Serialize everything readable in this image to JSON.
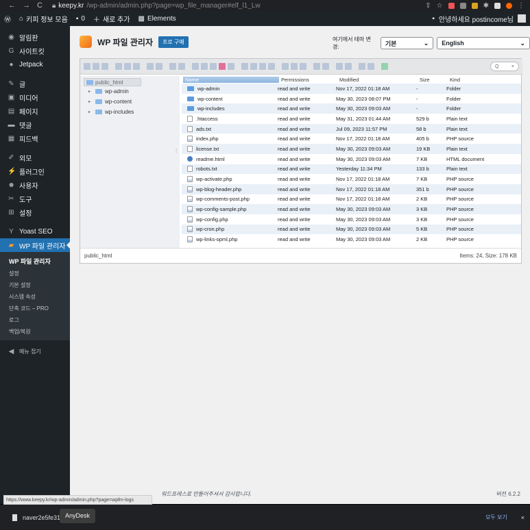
{
  "browser": {
    "nav_icons": [
      "back-icon",
      "forward-icon",
      "reload-icon"
    ],
    "url_host": "keepy.kr",
    "url_path": "/wp-admin/admin.php?page=wp_file_manager#elf_l1_Lw"
  },
  "adminbar": {
    "site_name": "키피 정보 모음",
    "comments_count": "0",
    "new_label": "새로 추가",
    "elements_label": "Elements",
    "greeting": "안녕하세요 postincome님"
  },
  "sidebar": {
    "items": [
      {
        "icon": "dashboard-icon",
        "label": "알림판"
      },
      {
        "icon": "g-icon",
        "label": "사이트킷"
      },
      {
        "icon": "jetpack-icon",
        "label": "Jetpack"
      },
      {
        "icon": "pin-icon",
        "label": "글"
      },
      {
        "icon": "media-icon",
        "label": "미디어"
      },
      {
        "icon": "page-icon",
        "label": "페이지"
      },
      {
        "icon": "comment-icon",
        "label": "댓글"
      },
      {
        "icon": "feedback-icon",
        "label": "피드백"
      },
      {
        "icon": "brush-icon",
        "label": "외모"
      },
      {
        "icon": "plugin-icon",
        "label": "플러그인"
      },
      {
        "icon": "user-icon",
        "label": "사용자"
      },
      {
        "icon": "wrench-icon",
        "label": "도구"
      },
      {
        "icon": "settings-icon",
        "label": "설정"
      },
      {
        "icon": "yoast-icon",
        "label": "Yoast SEO"
      },
      {
        "icon": "file-manager-icon",
        "label": "WP 파일 관리자"
      }
    ],
    "submenu": [
      "WP 파일 관리자",
      "설정",
      "기본 설정",
      "시스템 속성",
      "단축 코드 – PRO",
      "로그",
      "백업/복원"
    ],
    "collapse_label": "메뉴 접기"
  },
  "header": {
    "title": "WP 파일 관리자",
    "pro_button": "프로 구매",
    "theme_label": "여기에서 테마 변경:",
    "theme_value": "기본",
    "language_value": "English"
  },
  "tree": {
    "root": "public_html",
    "folders": [
      "wp-admin",
      "wp-content",
      "wp-includes"
    ]
  },
  "search": {
    "placeholder": "Q"
  },
  "columns": [
    "Name",
    "Permissions",
    "Modified",
    "Size",
    "Kind"
  ],
  "files": [
    {
      "name": "wp-admin",
      "perm": "read and write",
      "mod": "Nov 17, 2022 01:18 AM",
      "size": "-",
      "kind": "Folder",
      "icon": "folder"
    },
    {
      "name": "wp-content",
      "perm": "read and write",
      "mod": "May 30, 2023 08:07 PM",
      "size": "-",
      "kind": "Folder",
      "icon": "folder"
    },
    {
      "name": "wp-includes",
      "perm": "read and write",
      "mod": "May 30, 2023 09:03 AM",
      "size": "-",
      "kind": "Folder",
      "icon": "folder"
    },
    {
      "name": ".htaccess",
      "perm": "read and write",
      "mod": "May 31, 2023 01:44 AM",
      "size": "529 b",
      "kind": "Plain text",
      "icon": "text"
    },
    {
      "name": "ads.txt",
      "perm": "read and write",
      "mod": "Jul 09, 2023 11:57 PM",
      "size": "58 b",
      "kind": "Plain text",
      "icon": "text"
    },
    {
      "name": "index.php",
      "perm": "read and write",
      "mod": "Nov 17, 2022 01:18 AM",
      "size": "405 b",
      "kind": "PHP source",
      "icon": "php"
    },
    {
      "name": "license.txt",
      "perm": "read and write",
      "mod": "May 30, 2023 09:03 AM",
      "size": "19 KB",
      "kind": "Plain text",
      "icon": "text"
    },
    {
      "name": "readme.html",
      "perm": "read and write",
      "mod": "May 30, 2023 09:03 AM",
      "size": "7 KB",
      "kind": "HTML document",
      "icon": "html"
    },
    {
      "name": "robots.txt",
      "perm": "read and write",
      "mod": "Yesterday 11:34 PM",
      "size": "133 b",
      "kind": "Plain text",
      "icon": "text"
    },
    {
      "name": "wp-activate.php",
      "perm": "read and write",
      "mod": "Nov 17, 2022 01:18 AM",
      "size": "7 KB",
      "kind": "PHP source",
      "icon": "php"
    },
    {
      "name": "wp-blog-header.php",
      "perm": "read and write",
      "mod": "Nov 17, 2022 01:18 AM",
      "size": "351 b",
      "kind": "PHP source",
      "icon": "php"
    },
    {
      "name": "wp-comments-post.php",
      "perm": "read and write",
      "mod": "Nov 17, 2022 01:18 AM",
      "size": "2 KB",
      "kind": "PHP source",
      "icon": "php"
    },
    {
      "name": "wp-config-sample.php",
      "perm": "read and write",
      "mod": "May 30, 2023 09:03 AM",
      "size": "3 KB",
      "kind": "PHP source",
      "icon": "php"
    },
    {
      "name": "wp-config.php",
      "perm": "read and write",
      "mod": "May 30, 2023 09:03 AM",
      "size": "3 KB",
      "kind": "PHP source",
      "icon": "php"
    },
    {
      "name": "wp-cron.php",
      "perm": "read and write",
      "mod": "May 30, 2023 09:03 AM",
      "size": "5 KB",
      "kind": "PHP source",
      "icon": "php"
    },
    {
      "name": "wp-links-opml.php",
      "perm": "read and write",
      "mod": "May 30, 2023 09:03 AM",
      "size": "2 KB",
      "kind": "PHP source",
      "icon": "php"
    }
  ],
  "status": {
    "path": "public_html",
    "summary": "Items: 24, Size: 178 KB"
  },
  "footer": {
    "credit": "워드프레스로 만들어주셔서 감사합니다.",
    "version": "버전 6.2.2"
  },
  "status_url": "https://www.keepy.kr/wp-admin/admin.php?page=wpfm-logs",
  "downloads": {
    "filename": "naver2e5fe31",
    "tooltip": "AnyDesk",
    "show_all": "모두 보기",
    "close": "×"
  }
}
